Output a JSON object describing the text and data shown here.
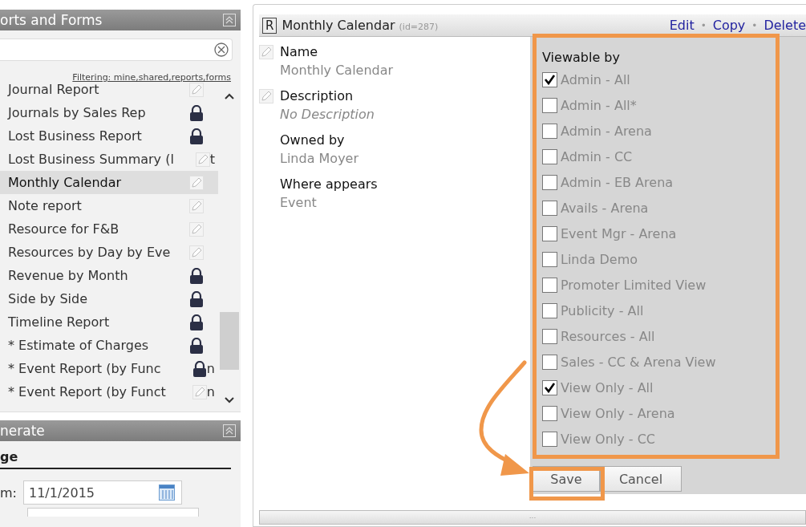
{
  "reports_panel": {
    "title": "orts and Forms",
    "filter_link": "Filtering: mine,shared,reports,forms",
    "items": [
      {
        "label": "Journal Report",
        "kind": "editable",
        "selected": false
      },
      {
        "label": "Journals by Sales Rep",
        "kind": "locked",
        "selected": false
      },
      {
        "label": "Lost Business Report",
        "kind": "locked",
        "selected": false
      },
      {
        "label": "Lost Business Summary (l",
        "kind": "editable",
        "tail": "t",
        "selected": false
      },
      {
        "label": "Monthly Calendar",
        "kind": "editable",
        "selected": true
      },
      {
        "label": "Note report",
        "kind": "editable",
        "selected": false
      },
      {
        "label": "Resource for F&B",
        "kind": "editable",
        "selected": false
      },
      {
        "label": "Resources by Day by Eve",
        "kind": "editable",
        "selected": false
      },
      {
        "label": "Revenue by Month",
        "kind": "locked",
        "selected": false
      },
      {
        "label": "Side by Side",
        "kind": "locked",
        "selected": false
      },
      {
        "label": "Timeline Report",
        "kind": "locked",
        "selected": false
      },
      {
        "label": "* Estimate of Charges",
        "kind": "locked",
        "selected": false
      },
      {
        "label": "* Event Report (by Func",
        "kind": "locked",
        "tail": "n",
        "selected": false
      },
      {
        "label": "* Event Report (by Funct",
        "kind": "editable",
        "tail": "n",
        "selected": false
      }
    ]
  },
  "generate_panel": {
    "title": "nerate",
    "section": "ge",
    "from_label": "m:",
    "from_value": "11/1/2015"
  },
  "report": {
    "badge": "R",
    "title": "Monthly Calendar",
    "id_text": "(id=287)",
    "separator": "•",
    "actions": [
      "Edit",
      "Copy",
      "Delete"
    ],
    "fields": [
      {
        "label": "Name",
        "value": "Monthly Calendar",
        "editable": true,
        "empty": false
      },
      {
        "label": "Description",
        "value": "No Description",
        "editable": true,
        "empty": true
      },
      {
        "label": "Owned by",
        "value": "Linda Moyer",
        "editable": false,
        "empty": false
      },
      {
        "label": "Where appears",
        "value": "Event",
        "editable": false,
        "empty": false
      }
    ],
    "viewable_by": {
      "title": "Viewable by",
      "options": [
        {
          "label": "Admin - All",
          "checked": true
        },
        {
          "label": "Admin - All*",
          "checked": false
        },
        {
          "label": "Admin - Arena",
          "checked": false
        },
        {
          "label": "Admin - CC",
          "checked": false
        },
        {
          "label": "Admin - EB Arena",
          "checked": false
        },
        {
          "label": "Avails - Arena",
          "checked": false
        },
        {
          "label": "Event Mgr - Arena",
          "checked": false
        },
        {
          "label": "Linda Demo",
          "checked": false
        },
        {
          "label": "Promoter Limited View",
          "checked": false
        },
        {
          "label": "Publicity - All",
          "checked": false
        },
        {
          "label": "Resources - All",
          "checked": false
        },
        {
          "label": "Sales - CC & Arena View",
          "checked": false
        },
        {
          "label": "View Only - All",
          "checked": true
        },
        {
          "label": "View Only - Arena",
          "checked": false
        },
        {
          "label": "View Only - CC",
          "checked": false
        }
      ]
    },
    "buttons": [
      "Save",
      "Cancel"
    ],
    "footer_grip": "..."
  }
}
